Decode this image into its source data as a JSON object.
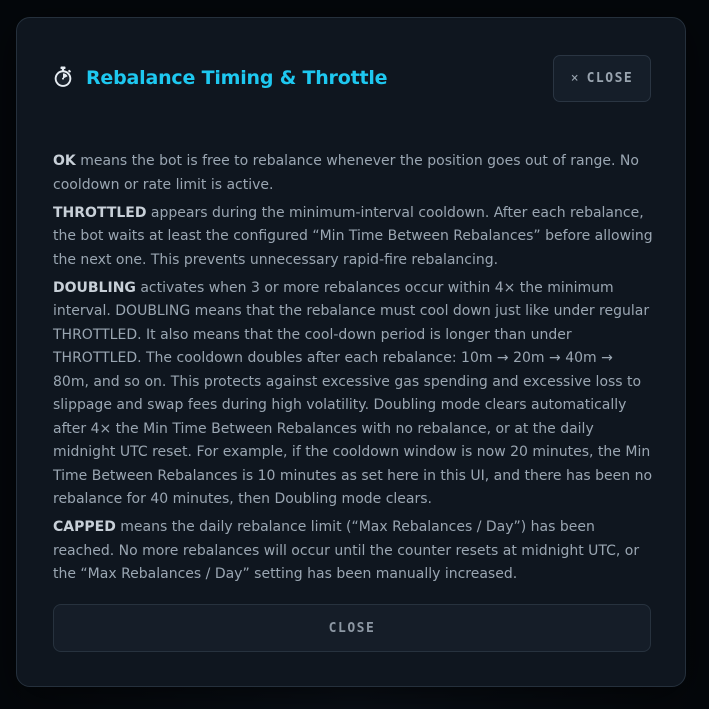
{
  "modal": {
    "title": "Rebalance Timing & Throttle",
    "title_icon": "stopwatch-icon",
    "close_top_label": "CLOSE",
    "close_top_icon": "×",
    "close_bottom_label": "CLOSE"
  },
  "sections": [
    {
      "term": "OK",
      "text": " means the bot is free to rebalance whenever the position goes out of range. No cooldown or rate limit is active."
    },
    {
      "term": "THROTTLED",
      "text": " appears during the minimum-interval cooldown. After each rebalance, the bot waits at least the configured “Min Time Between Rebalances” before allowing the next one. This prevents unnecessary rapid-fire rebalancing."
    },
    {
      "term": "DOUBLING",
      "text": " activates when 3 or more rebalances occur within 4× the minimum interval. DOUBLING means that the rebalance must cool down just like under regular THROTTLED. It also means that the cool-down period is longer than under THROTTLED. The cooldown doubles after each rebalance: 10m → 20m → 40m → 80m, and so on. This protects against excessive gas spending and excessive loss to slippage and swap fees during high volatility. Doubling mode clears automatically after 4× the Min Time Between Rebalances with no rebalance, or at the daily midnight UTC reset. For example, if the cooldown window is now 20 minutes, the Min Time Between Rebalances is 10 minutes as set here in this UI, and there has been no rebalance for 40 minutes, then Doubling mode clears."
    },
    {
      "term": "CAPPED",
      "text": " means the daily rebalance limit (“Max Rebalances / Day”) has been reached. No more rebalances will occur until the counter resets at midnight UTC, or the “Max Rebalances / Day” setting has been manually increased."
    }
  ],
  "colors": {
    "accent": "#1ec8f0",
    "background": "#0f161f",
    "text": "#9aa6b2",
    "term": "#c8d0d8"
  }
}
